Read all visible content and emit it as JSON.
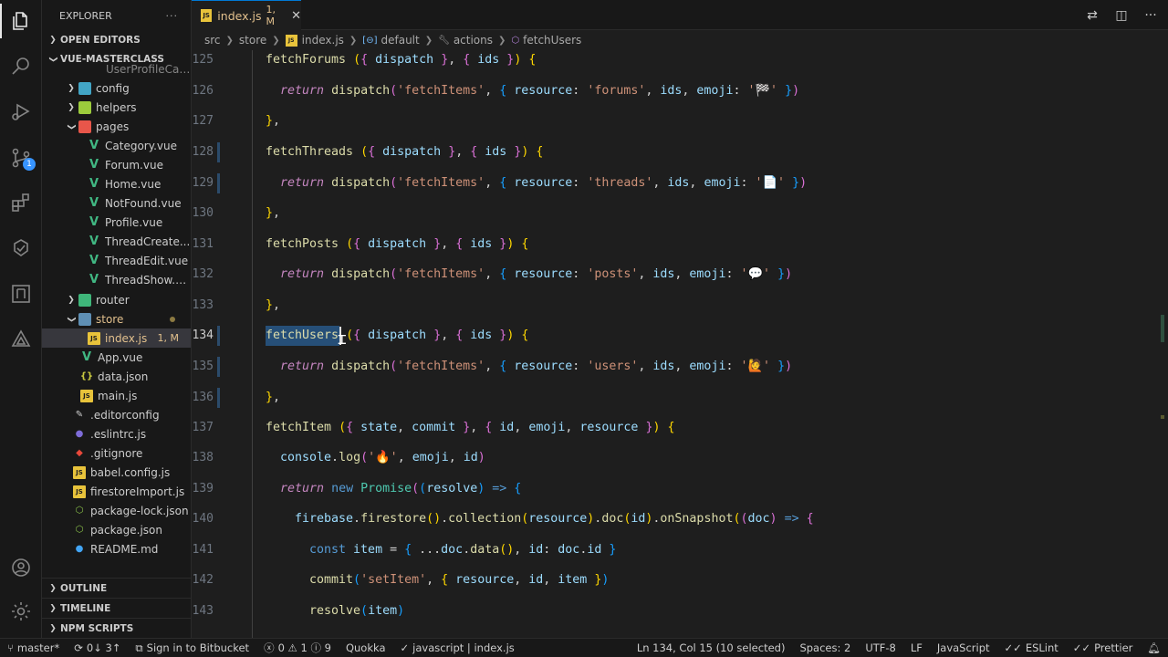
{
  "sidebar": {
    "title": "EXPLORER",
    "more": "···",
    "open_editors": "OPEN EDITORS",
    "project": "VUE-MASTERCLASS",
    "items": [
      {
        "label": "UserProfileCar..."
      },
      {
        "label": "config"
      },
      {
        "label": "helpers"
      },
      {
        "label": "pages"
      },
      {
        "label": "Category.vue"
      },
      {
        "label": "Forum.vue"
      },
      {
        "label": "Home.vue"
      },
      {
        "label": "NotFound.vue"
      },
      {
        "label": "Profile.vue"
      },
      {
        "label": "ThreadCreate..."
      },
      {
        "label": "ThreadEdit.vue"
      },
      {
        "label": "ThreadShow.vue"
      },
      {
        "label": "router"
      },
      {
        "label": "store"
      },
      {
        "label": "index.js",
        "tag": "1, M"
      },
      {
        "label": "App.vue"
      },
      {
        "label": "data.json"
      },
      {
        "label": "main.js"
      },
      {
        "label": ".editorconfig"
      },
      {
        "label": ".eslintrc.js"
      },
      {
        "label": ".gitignore"
      },
      {
        "label": "babel.config.js"
      },
      {
        "label": "firestoreImport.js"
      },
      {
        "label": "package-lock.json"
      },
      {
        "label": "package.json"
      },
      {
        "label": "README.md"
      }
    ],
    "outline": "OUTLINE",
    "timeline": "TIMELINE",
    "npm_scripts": "NPM SCRIPTS"
  },
  "activity": {
    "scm_badge": "1"
  },
  "tab": {
    "name": "index.js",
    "status": "1, M",
    "close": "✕",
    "js": "JS"
  },
  "breadcrumb": [
    "src",
    "store",
    "index.js",
    "default",
    "actions",
    "fetchUsers"
  ],
  "editor": {
    "lines": [
      {
        "n": "125"
      },
      {
        "n": "126"
      },
      {
        "n": "127"
      },
      {
        "n": "128"
      },
      {
        "n": "129"
      },
      {
        "n": "130"
      },
      {
        "n": "131"
      },
      {
        "n": "132"
      },
      {
        "n": "133"
      },
      {
        "n": "134"
      },
      {
        "n": "135"
      },
      {
        "n": "136"
      },
      {
        "n": "137"
      },
      {
        "n": "138"
      },
      {
        "n": "139"
      },
      {
        "n": "140"
      },
      {
        "n": "141"
      },
      {
        "n": "142"
      },
      {
        "n": "143"
      }
    ]
  },
  "status": {
    "branch": "master*",
    "sync": "0↓ 3↑",
    "bitbucket": "Sign in to Bitbucket",
    "problems": "0 ⚠ 1 ⓘ 9",
    "quokka": "Quokka",
    "language_path": "javascript | index.js",
    "position": "Ln 134, Col 15 (10 selected)",
    "spaces": "Spaces: 2",
    "encoding": "UTF-8",
    "eol": "LF",
    "language": "JavaScript",
    "eslint": "ESLint",
    "prettier": "Prettier"
  }
}
